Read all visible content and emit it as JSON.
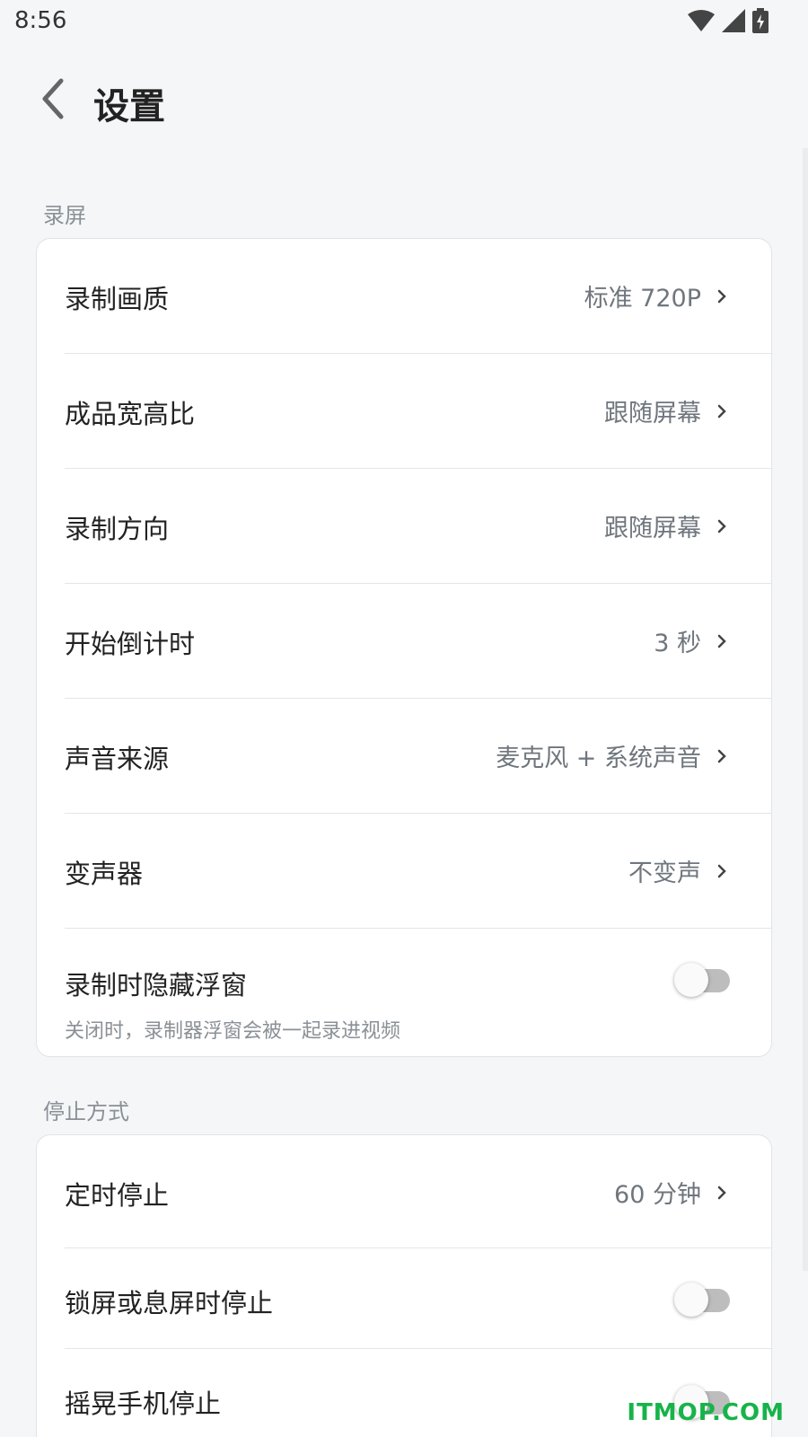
{
  "status_bar": {
    "time": "8:56"
  },
  "header": {
    "title": "设置"
  },
  "sections": [
    {
      "title": "录屏",
      "rows": [
        {
          "label": "录制画质",
          "value": "标准 720P"
        },
        {
          "label": "成品宽高比",
          "value": "跟随屏幕"
        },
        {
          "label": "录制方向",
          "value": "跟随屏幕"
        },
        {
          "label": "开始倒计时",
          "value": "3 秒"
        },
        {
          "label": "声音来源",
          "value": "麦克风 + 系统声音"
        },
        {
          "label": "变声器",
          "value": "不变声"
        },
        {
          "label": "录制时隐藏浮窗",
          "sub": "关闭时，录制器浮窗会被一起录进视频",
          "toggle_on": false
        }
      ]
    },
    {
      "title": "停止方式",
      "rows": [
        {
          "label": "定时停止",
          "value": "60 分钟"
        },
        {
          "label": "锁屏或息屏时停止",
          "toggle_on": false
        },
        {
          "label": "摇晃手机停止",
          "toggle_on": false
        }
      ]
    }
  ],
  "watermark": "ITMOP.COM"
}
